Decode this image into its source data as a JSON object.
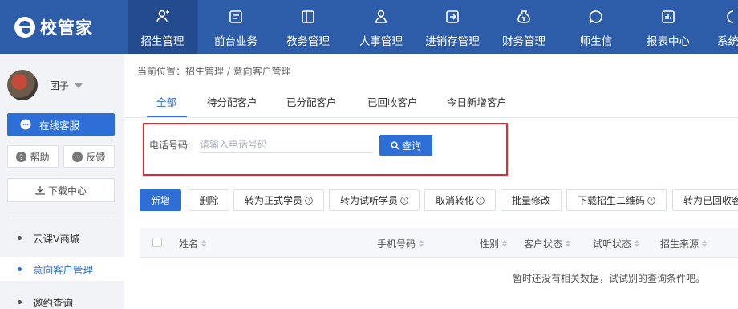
{
  "app": {
    "name": "校管家"
  },
  "nav": {
    "items": [
      {
        "label": "招生管理",
        "icon": "user-plus-icon",
        "active": true
      },
      {
        "label": "前台业务",
        "icon": "desk-icon"
      },
      {
        "label": "教务管理",
        "icon": "book-icon"
      },
      {
        "label": "人事管理",
        "icon": "person-icon"
      },
      {
        "label": "进销存管理",
        "icon": "inventory-icon"
      },
      {
        "label": "财务管理",
        "icon": "money-bag-icon"
      },
      {
        "label": "师生信",
        "icon": "chat-bubble-icon"
      },
      {
        "label": "报表中心",
        "icon": "chart-icon"
      },
      {
        "label": "系统",
        "icon": "system-icon"
      }
    ]
  },
  "sidebar": {
    "username": "团子",
    "service_label": "在线客服",
    "help_label": "帮助",
    "feedback_label": "反馈",
    "download_label": "下载中心",
    "menu": [
      {
        "label": "云课V商城"
      },
      {
        "label": "意向客户管理",
        "active": true
      },
      {
        "label": "邀约查询"
      }
    ]
  },
  "breadcrumb": "当前位置：招生管理 / 意向客户管理",
  "tabs": [
    {
      "label": "全部",
      "active": true
    },
    {
      "label": "待分配客户"
    },
    {
      "label": "已分配客户"
    },
    {
      "label": "已回收客户"
    },
    {
      "label": "今日新增客户"
    }
  ],
  "search": {
    "label": "电话号码:",
    "placeholder": "请输入电话号码",
    "button": "查询"
  },
  "toolbar": [
    {
      "label": "新增",
      "primary": true
    },
    {
      "label": "删除"
    },
    {
      "label": "转为正式学员",
      "help": true
    },
    {
      "label": "转为试听学员",
      "help": true
    },
    {
      "label": "取消转化",
      "help": true
    },
    {
      "label": "批量修改"
    },
    {
      "label": "下载招生二维码",
      "help": true
    },
    {
      "label": "转为已回收客户"
    }
  ],
  "table": {
    "columns": [
      "姓名",
      "手机号码",
      "性别",
      "客户状态",
      "试听状态",
      "招生来源"
    ],
    "empty_text": "暂时还没有相关数据，试试别的查询条件吧。"
  },
  "colors": {
    "nav_bg": "#2d5ca8",
    "accent": "#2d6fd6",
    "highlight_border": "#e8262f"
  }
}
